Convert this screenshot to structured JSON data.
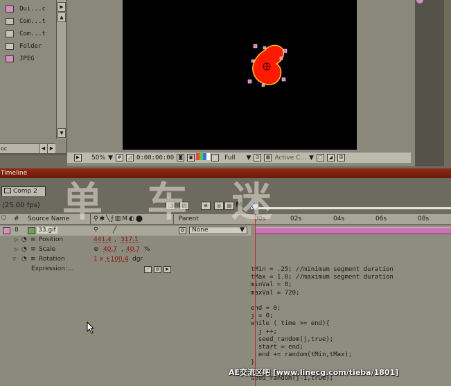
{
  "project": {
    "items": [
      {
        "label": "Qui...c",
        "type": "pink"
      },
      {
        "label": "Com...t",
        "type": "comp"
      },
      {
        "label": "Com...t",
        "type": "comp"
      },
      {
        "label": "Folder",
        "type": "folder"
      },
      {
        "label": "JPEG",
        "type": "pink"
      }
    ],
    "scroll_label": "oc"
  },
  "viewer": {
    "zoom": "50%",
    "timecode": "0:00:00:00",
    "resolution": "Full",
    "camera": "Active C...",
    "color_swatches": [
      "#ff3b3b",
      "#3bd63b",
      "#3b6bff",
      "#ffffff"
    ]
  },
  "timeline": {
    "panel_title": "Timeline",
    "tab_label": "Comp 2",
    "fps": "(25.00 fps)",
    "col_number": "#",
    "col_source": "Source Name",
    "col_parent": "Parent",
    "layer": {
      "index": "8",
      "name": "33.gif",
      "parent": "None"
    },
    "properties": {
      "position_label": "Position",
      "position_x": "441.4",
      "position_y": "317.1",
      "scale_label": "Scale",
      "scale_x": "40.7",
      "scale_y": "40.7",
      "scale_unit": "%",
      "rotation_label": "Rotation",
      "rotation_rev": "1 x",
      "rotation_deg": "+100.4",
      "rotation_unit": "dgr",
      "expression_label": "Expression:..."
    },
    "ruler_ticks": [
      "00s",
      "02s",
      "04s",
      "06s",
      "08s"
    ],
    "expression_lines": [
      "tMin = .25; //minimum segment duration",
      "tMax = 1.0; //maximum segment duration",
      "minVal = 0;",
      "maxVal = 720;",
      "",
      "end = 0;",
      "j = 0;",
      "while ( time >= end){",
      "  j ++;",
      "  seed_random(j,true);",
      "  start = end;",
      "  end += random(tMin,tMax);",
      "}",
      "",
      "seed_random(j-1,true);"
    ]
  },
  "watermark": "单 车 迷",
  "credit": "AE交流区吧 [www.linecg.com/tieba/1801]",
  "colors": {
    "timeline_red": "#7c2010",
    "layer_bar": "#c873b2",
    "shape_fill": "#ff1a00",
    "cti": "#c9271c"
  }
}
